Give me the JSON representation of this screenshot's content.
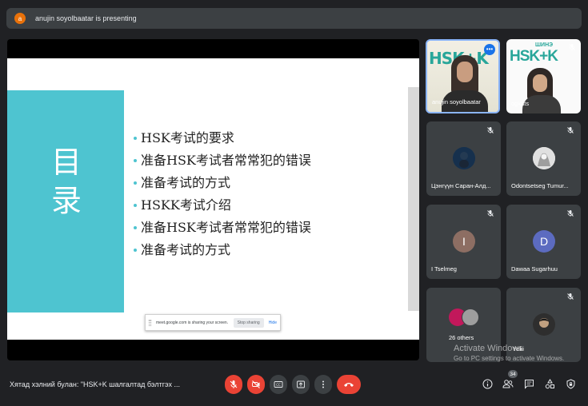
{
  "banner": {
    "avatar_letter": "a",
    "text": "anujin soyolbaatar is presenting"
  },
  "slide": {
    "title": "目录",
    "bullets": [
      "HSK考试的要求",
      "准备HSK考试者常常犯的错误",
      "准备考试的方式",
      "HSKK考试介绍",
      "准备HSK考试者常常犯的错误",
      "准备考试的方式"
    ]
  },
  "share_bar": {
    "message": "meet.google.com is sharing your screen.",
    "stop_label": "Stop sharing",
    "hide_label": "Hide"
  },
  "tiles": {
    "presenter": {
      "name": "anujin soyolbaatar",
      "banner_text": "HSK+K"
    },
    "second": {
      "name": "ogkats",
      "top_text": "ШИНЭ",
      "banner_text": "HSK+K"
    },
    "participants": [
      {
        "name": "Цэнгүүн Саран-Алд...",
        "letter": ""
      },
      {
        "name": "Odontsetseg Tumur...",
        "letter": ""
      },
      {
        "name": "I Tselmeg",
        "letter": "I"
      },
      {
        "name": "Dawaa Sugarhuu",
        "letter": "D"
      },
      {
        "name": "26 others",
        "letter": ""
      },
      {
        "name": "Yoki",
        "letter": ""
      }
    ]
  },
  "watermark": {
    "line1": "Activate Windows",
    "line2": "Go to PC settings to activate Windows."
  },
  "bottom": {
    "meeting_title": "Хятад хэлний булан: \"HSK+K шалгалтад бэлтгэх ...",
    "participant_count": "34"
  },
  "colors": {
    "accent_teal": "#4ec4d0",
    "red": "#ea4335",
    "bg": "#202124",
    "tile": "#3c4043"
  }
}
